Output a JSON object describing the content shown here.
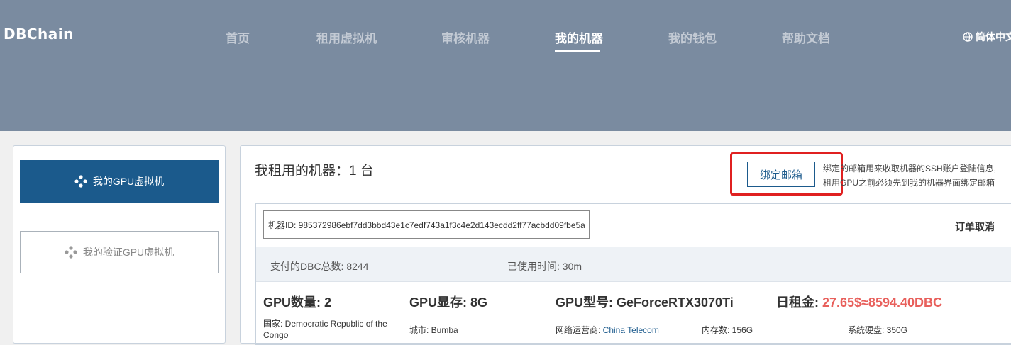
{
  "header": {
    "logo": "DBChain",
    "nav": [
      {
        "label": "首页",
        "active": false
      },
      {
        "label": "租用虚拟机",
        "active": false
      },
      {
        "label": "审核机器",
        "active": false
      },
      {
        "label": "我的机器",
        "active": true
      },
      {
        "label": "我的钱包",
        "active": false
      },
      {
        "label": "帮助文档",
        "active": false
      }
    ],
    "language": "简体中文"
  },
  "sidebar": {
    "items": [
      {
        "label": "我的GPU虚拟机",
        "icon": "diamond-dots-icon",
        "selected": true
      },
      {
        "label": "我的验证GPU虚拟机",
        "icon": "diamond-dots-icon",
        "selected": false
      }
    ]
  },
  "main": {
    "title": "我租用的机器：1 台",
    "bind_email_label": "绑定邮箱",
    "bind_note_line1": "绑定的邮箱用来收取机器的SSH账户登陆信息,",
    "bind_note_line2": "租用GPU之前必须先到我的机器界面绑定邮箱",
    "highlight_color": "#e02020",
    "machine": {
      "id_text": "机器ID: 985372986ebf7dd3bbd43e1c7edf743a1f3c4e2d143ecdd2ff77acbdd09fbe5a",
      "cancel_label": "订单取消",
      "paid_dbc": "支付的DBC总数: 8244",
      "used_time": "已使用时间: 30m",
      "gpu_count": "GPU数量: 2",
      "gpu_memory": "GPU显存: 8G",
      "gpu_model": "GPU型号: GeForceRTX3070Ti",
      "daily_rent_label": "日租金: ",
      "daily_rent_value": "27.65$≈8594.40DBC",
      "country_label": "国家: ",
      "country_value": "Democratic Republic of the Congo",
      "city_label": "城市: ",
      "city_value": "Bumba",
      "isp_label": "网络运营商: ",
      "isp_value": "China Telecom",
      "memory_label": "内存数: ",
      "memory_value": "156G",
      "disk_label": "系统硬盘: ",
      "disk_value": "350G"
    }
  }
}
